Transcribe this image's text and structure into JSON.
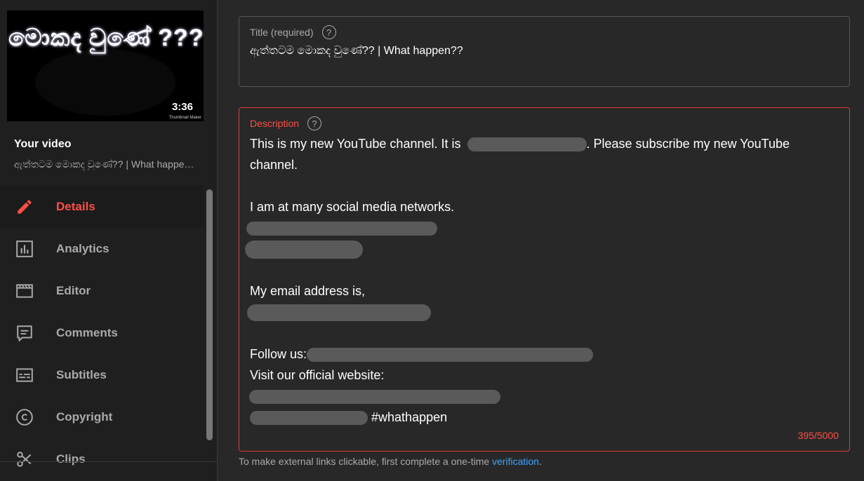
{
  "sidebar": {
    "thumbnail": {
      "overlay_text": "මොකද වුණේ ???",
      "duration": "3:36",
      "maker": "Thumbnail Maker"
    },
    "your_video_label": "Your video",
    "video_title": "ඇත්තටම මොකද වුණේ?? | What happe…",
    "items": [
      {
        "label": "Details",
        "icon": "pencil-icon"
      },
      {
        "label": "Analytics",
        "icon": "analytics-icon"
      },
      {
        "label": "Editor",
        "icon": "editor-icon"
      },
      {
        "label": "Comments",
        "icon": "comments-icon"
      },
      {
        "label": "Subtitles",
        "icon": "subtitles-icon"
      },
      {
        "label": "Copyright",
        "icon": "copyright-icon"
      },
      {
        "label": "Clips",
        "icon": "clips-icon"
      }
    ],
    "active_index": 0
  },
  "title_field": {
    "label": "Title (required)",
    "value": "ඇත්තටම මොකද වුණේ?? | What happen??"
  },
  "description_field": {
    "label": "Description",
    "lines": {
      "l1_a": "This is my new YouTube channel. It is",
      "l1_b": ". Please subscribe my new YouTube",
      "l2": "channel.",
      "l4": "I am at many social media networks.",
      "l8": "My email address is,",
      "l11": "Follow us:",
      "l12": "Visit our official website:",
      "l14_b": "#whathappen"
    },
    "char_count": "395/5000"
  },
  "hint": {
    "text": "To make external links clickable, first complete a one-time",
    "link": "verification",
    "end": "."
  },
  "colors": {
    "accent": "#ff4e45",
    "link": "#3ea6ff",
    "background": "#282828",
    "sidebar": "#1f1f1f"
  }
}
